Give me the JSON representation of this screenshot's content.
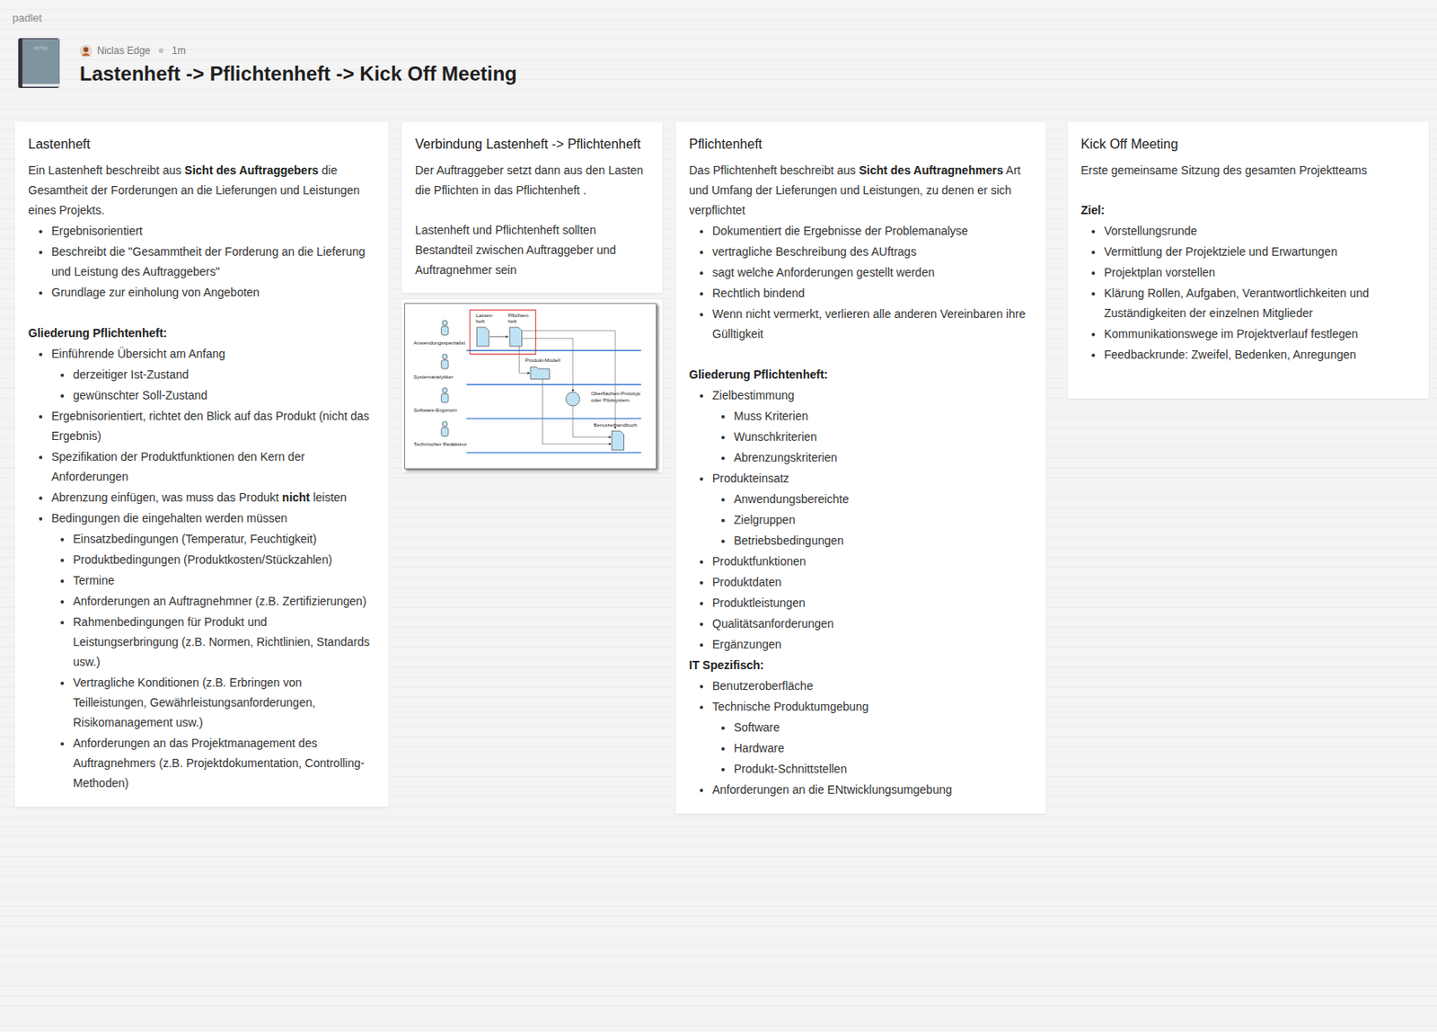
{
  "app": {
    "brand": "padlet"
  },
  "header": {
    "notebook_label": "NOTES",
    "author": "Niclas Edge",
    "time": "1m",
    "title": "Lastenheft -> Pflichtenheft -> Kick Off Meeting"
  },
  "columns": [
    {
      "cards": [
        {
          "kind": "text",
          "title": "Lastenheft",
          "blocks": [
            {
              "kind": "p",
              "parts": [
                {
                  "text": "Ein Lastenheft beschreibt aus "
                },
                {
                  "text": "Sicht des Auftraggebers",
                  "bold": true
                },
                {
                  "text": " die Gesamtheit der Forderungen an die Lieferungen und Leistungen eines Projekts."
                }
              ]
            },
            {
              "kind": "ul",
              "items": [
                {
                  "text": "Ergebnisorientiert"
                },
                {
                  "text": "Beschreibt die \"Gesammtheit der Forderung an die Lieferung und Leistung des Auftraggebers\""
                },
                {
                  "text": "Grundlage zur einholung von Angeboten"
                }
              ]
            },
            {
              "kind": "blank"
            },
            {
              "kind": "heading",
              "text": "Gliederung Pflichtenheft:"
            },
            {
              "kind": "ul",
              "items": [
                {
                  "text": "Einführende Übersicht am Anfang",
                  "children": [
                    {
                      "text": "derzeitiger Ist-Zustand"
                    },
                    {
                      "text": "gewünschter Soll-Zustand"
                    }
                  ]
                },
                {
                  "text": "Ergebnisorientiert, richtet den Blick auf das Produkt (nicht das Ergebnis)"
                },
                {
                  "text": "Spezifikation der Produktfunktionen den Kern der Anforderungen"
                },
                {
                  "parts": [
                    {
                      "text": "Abrenzung einfügen, was muss das Produkt "
                    },
                    {
                      "text": "nicht",
                      "bold": true
                    },
                    {
                      "text": " leisten"
                    }
                  ]
                },
                {
                  "text": "Bedingungen die eingehalten werden müssen",
                  "children": [
                    {
                      "text": "Einsatzbedingungen (Temperatur, Feuchtigkeit)"
                    },
                    {
                      "text": "Produktbedingungen (Produktkosten/Stückzahlen)"
                    },
                    {
                      "text": "Termine"
                    },
                    {
                      "text": "Anforderungen an Auftragnehmner (z.B. Zertifizierungen)"
                    },
                    {
                      "text": "Rahmenbedingungen für Produkt und Leistungserbringung (z.B. Normen, Richtlinien, Standards usw.)"
                    },
                    {
                      "text": "Vertragliche Konditionen (z.B. Erbringen von Teilleistungen, Gewährleistungsanforderungen, Risikomanagement usw.)"
                    },
                    {
                      "text": "Anforderungen an das Projektmanagement des Auftragnehmers (z.B. Projektdokumentation, Controlling-Methoden)"
                    }
                  ]
                }
              ]
            }
          ]
        }
      ]
    },
    {
      "cards": [
        {
          "kind": "text",
          "title": "Verbindung Lastenheft -> Pflichtenheft",
          "blocks": [
            {
              "kind": "p",
              "parts": [
                {
                  "text": "Der Auftraggeber setzt dann aus den Lasten die Pflichten in das Pflichtenheft ."
                }
              ]
            },
            {
              "kind": "blank"
            },
            {
              "kind": "p",
              "parts": [
                {
                  "text": "Lastenheft und Pflichtenheft sollten Bestandteil zwischen Auftraggeber und Auftragnehmer sein"
                }
              ]
            }
          ]
        },
        {
          "kind": "diagram",
          "roles": [
            "Anwendungsspezialist",
            "Systemanalytiker",
            "Software-Ergonom",
            "Technischer Redakteur"
          ],
          "lastenheft": [
            "Lasten-",
            "heft"
          ],
          "pflichtenheft": [
            "Pflichten-",
            "heft"
          ],
          "modell": "Produkt-Modell",
          "prototyp": [
            "Oberflächen-Prototyp",
            "oder Pilotsystem"
          ],
          "handbuch": "Benutzerhandbuch"
        }
      ]
    },
    {
      "cards": [
        {
          "kind": "text",
          "title": "Pflichtenheft",
          "blocks": [
            {
              "kind": "p",
              "parts": [
                {
                  "text": "Das Pflichtenheft beschreibt aus "
                },
                {
                  "text": "Sicht des Auftragnehmers",
                  "bold": true
                },
                {
                  "text": " Art und Umfang der Lieferungen und Leistungen, zu denen er sich verpflichtet"
                }
              ]
            },
            {
              "kind": "ul",
              "items": [
                {
                  "text": "Dokumentiert die Ergebnisse der Problemanalyse"
                },
                {
                  "text": "vertragliche Beschreibung des AUftrags"
                },
                {
                  "text": "sagt welche Anforderungen gestellt werden"
                },
                {
                  "text": "Rechtlich bindend"
                },
                {
                  "text": "Wenn nicht vermerkt, verlieren alle anderen Vereinbaren ihre Gülltigkeit"
                }
              ]
            },
            {
              "kind": "blank"
            },
            {
              "kind": "heading",
              "text": "Gliederung Pflichtenheft:"
            },
            {
              "kind": "ul",
              "items": [
                {
                  "text": "Zielbestimmung",
                  "children": [
                    {
                      "text": "Muss Kriterien"
                    },
                    {
                      "text": "Wunschkriterien"
                    },
                    {
                      "text": "Abrenzungskriterien"
                    }
                  ]
                },
                {
                  "text": "Produkteinsatz",
                  "children": [
                    {
                      "text": "Anwendungsbereichte"
                    },
                    {
                      "text": "Zielgruppen"
                    },
                    {
                      "text": "Betriebsbedingungen"
                    }
                  ]
                },
                {
                  "text": "Produktfunktionen"
                },
                {
                  "text": "Produktdaten"
                },
                {
                  "text": "Produktleistungen"
                },
                {
                  "text": "Qualitätsanforderungen"
                },
                {
                  "text": "Ergänzungen"
                }
              ]
            },
            {
              "kind": "heading",
              "text": "IT Spezifisch:"
            },
            {
              "kind": "ul",
              "items": [
                {
                  "text": "Benutzeroberfläche"
                },
                {
                  "text": "Technische Produktumgebung",
                  "children": [
                    {
                      "text": "Software"
                    },
                    {
                      "text": "Hardware"
                    },
                    {
                      "text": "Produkt-Schnittstellen"
                    }
                  ]
                },
                {
                  "text": "Anforderungen an die ENtwicklungsumgebung"
                }
              ]
            }
          ]
        }
      ]
    },
    {
      "cards": [
        {
          "kind": "text",
          "title": "Kick Off Meeting",
          "blocks": [
            {
              "kind": "p",
              "parts": [
                {
                  "text": "Erste gemeinsame Sitzung des gesamten Projektteams"
                }
              ]
            },
            {
              "kind": "blank"
            },
            {
              "kind": "heading",
              "text": "Ziel:"
            },
            {
              "kind": "ul",
              "items": [
                {
                  "text": "Vorstellungsrunde"
                },
                {
                  "text": "Vermittlung der Projektziele und Erwartungen"
                },
                {
                  "text": "Projektplan vorstellen"
                },
                {
                  "text": "Klärung Rollen, Aufgaben, Verantwortlichkeiten und Zuständigkeiten der einzelnen Mitglieder"
                },
                {
                  "text": "Kommunikationswege im Projektverlauf festlegen"
                },
                {
                  "text": "Feedbackrunde: Zweifel, Bedenken, Anregungen"
                }
              ]
            },
            {
              "kind": "blank"
            }
          ]
        }
      ]
    }
  ]
}
